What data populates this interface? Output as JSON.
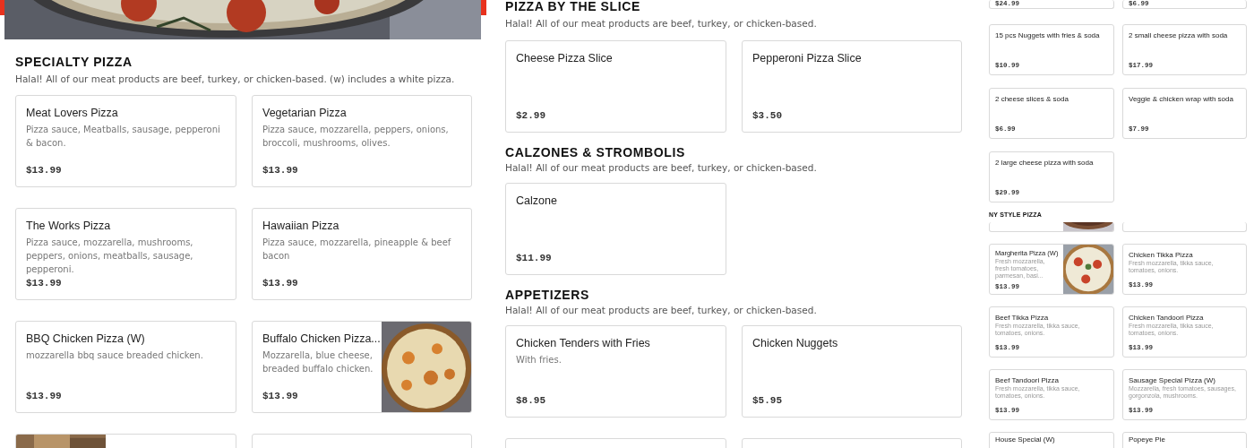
{
  "left": {
    "title": "SPECIALTY PIZZA",
    "note": "Halal! All of our meat products are beef, turkey, or chicken-based. (w) includes a white pizza.",
    "items": [
      {
        "name": "Meat Lovers Pizza",
        "description": "Pizza sauce, Meatballs, sausage, pepperoni & bacon.",
        "price": "$13.99"
      },
      {
        "name": "Vegetarian Pizza",
        "description": "Pizza sauce, mozzarella, peppers, onions, broccoli, mushrooms, olives.",
        "price": "$13.99"
      },
      {
        "name": "The Works Pizza",
        "description": "Pizza sauce, mozzarella, mushrooms, peppers, onions, meatballs, sausage, pepperoni.",
        "price": "$13.99"
      },
      {
        "name": "Hawaiian Pizza",
        "description": "Pizza sauce, mozzarella, pineapple & beef bacon",
        "price": "$13.99"
      },
      {
        "name": "BBQ Chicken Pizza (W)",
        "description": "mozzarella bbq sauce breaded chicken.",
        "price": "$13.99"
      },
      {
        "name": "Buffalo Chicken Pizza...",
        "description": "Mozzarella, blue cheese, breaded buffalo chicken.",
        "price": "$13.99",
        "picture": true
      },
      {
        "picture": true
      },
      {
        "picture": false
      }
    ]
  },
  "middle": [
    {
      "title": "PIZZA BY THE SLICE",
      "note": "Halal! All of our meat products are beef, turkey, or chicken-based.",
      "items": [
        {
          "name": "Cheese Pizza Slice",
          "price": "$2.99"
        },
        {
          "name": "Pepperoni Pizza Slice",
          "price": "$3.50"
        }
      ]
    },
    {
      "title": "CALZONES & STROMBOLIS",
      "note": "Halal! All of our meat products are beef, turkey, or chicken-based.",
      "items": [
        {
          "name": "Calzone",
          "price": "$11.99"
        }
      ]
    },
    {
      "title": "APPETIZERS",
      "note": "Halal! All of our meat products are beef, turkey, or chicken-based.",
      "items": [
        {
          "name": "Chicken Tenders with Fries",
          "description": "With fries.",
          "price": "$8.95"
        },
        {
          "name": "Chicken Nuggets",
          "price": "$5.95"
        },
        {
          "picture": false
        },
        {
          "picture": false
        }
      ]
    }
  ],
  "right": {
    "deals": [
      {
        "price": "$24.99"
      },
      {
        "price": "$6.99"
      },
      {
        "name": "15 pcs Nuggets with fries & soda",
        "price": "$10.99"
      },
      {
        "name": "2 small cheese pizza with soda",
        "price": "$17.99"
      },
      {
        "name": "2 cheese slices & soda",
        "price": "$6.99"
      },
      {
        "name": "Veggie & chicken wrap with soda",
        "price": "$7.99"
      },
      {
        "name": "2 large cheese pizza with soda",
        "price": "$29.99"
      }
    ],
    "title": "NY STYLE PIZZA",
    "items": [
      {
        "picture": true
      },
      {
        "picture": false
      },
      {
        "name": "Margherita Pizza (W)",
        "description": "Fresh mozzarella, fresh tomatoes, parmesan, basi...",
        "price": "$13.99",
        "picture": true
      },
      {
        "name": "Chicken Tikka Pizza",
        "description": "Fresh mozzarella, tikka sauce, tomatoes, onions.",
        "price": "$13.99"
      },
      {
        "name": "Beef Tikka Pizza",
        "description": "Fresh mozzarella, tikka sauce, tomatoes, onions.",
        "price": "$13.99"
      },
      {
        "name": "Chicken Tandoori Pizza",
        "description": "Fresh mozzarella, tikka sauce, tomatoes, onions.",
        "price": "$13.99"
      },
      {
        "name": "Beef Tandoori Pizza",
        "description": "Fresh mozzarella, tikka sauce, tomatoes, onions.",
        "price": "$13.99"
      },
      {
        "name": "Sausage Special Pizza (W)",
        "description": "Mozzarella, fresh tomatoes, sausages, gorgonzola, mushrooms.",
        "price": "$13.99"
      },
      {
        "name": "House Special (W)"
      },
      {
        "name": "Popeye Pie"
      }
    ]
  }
}
